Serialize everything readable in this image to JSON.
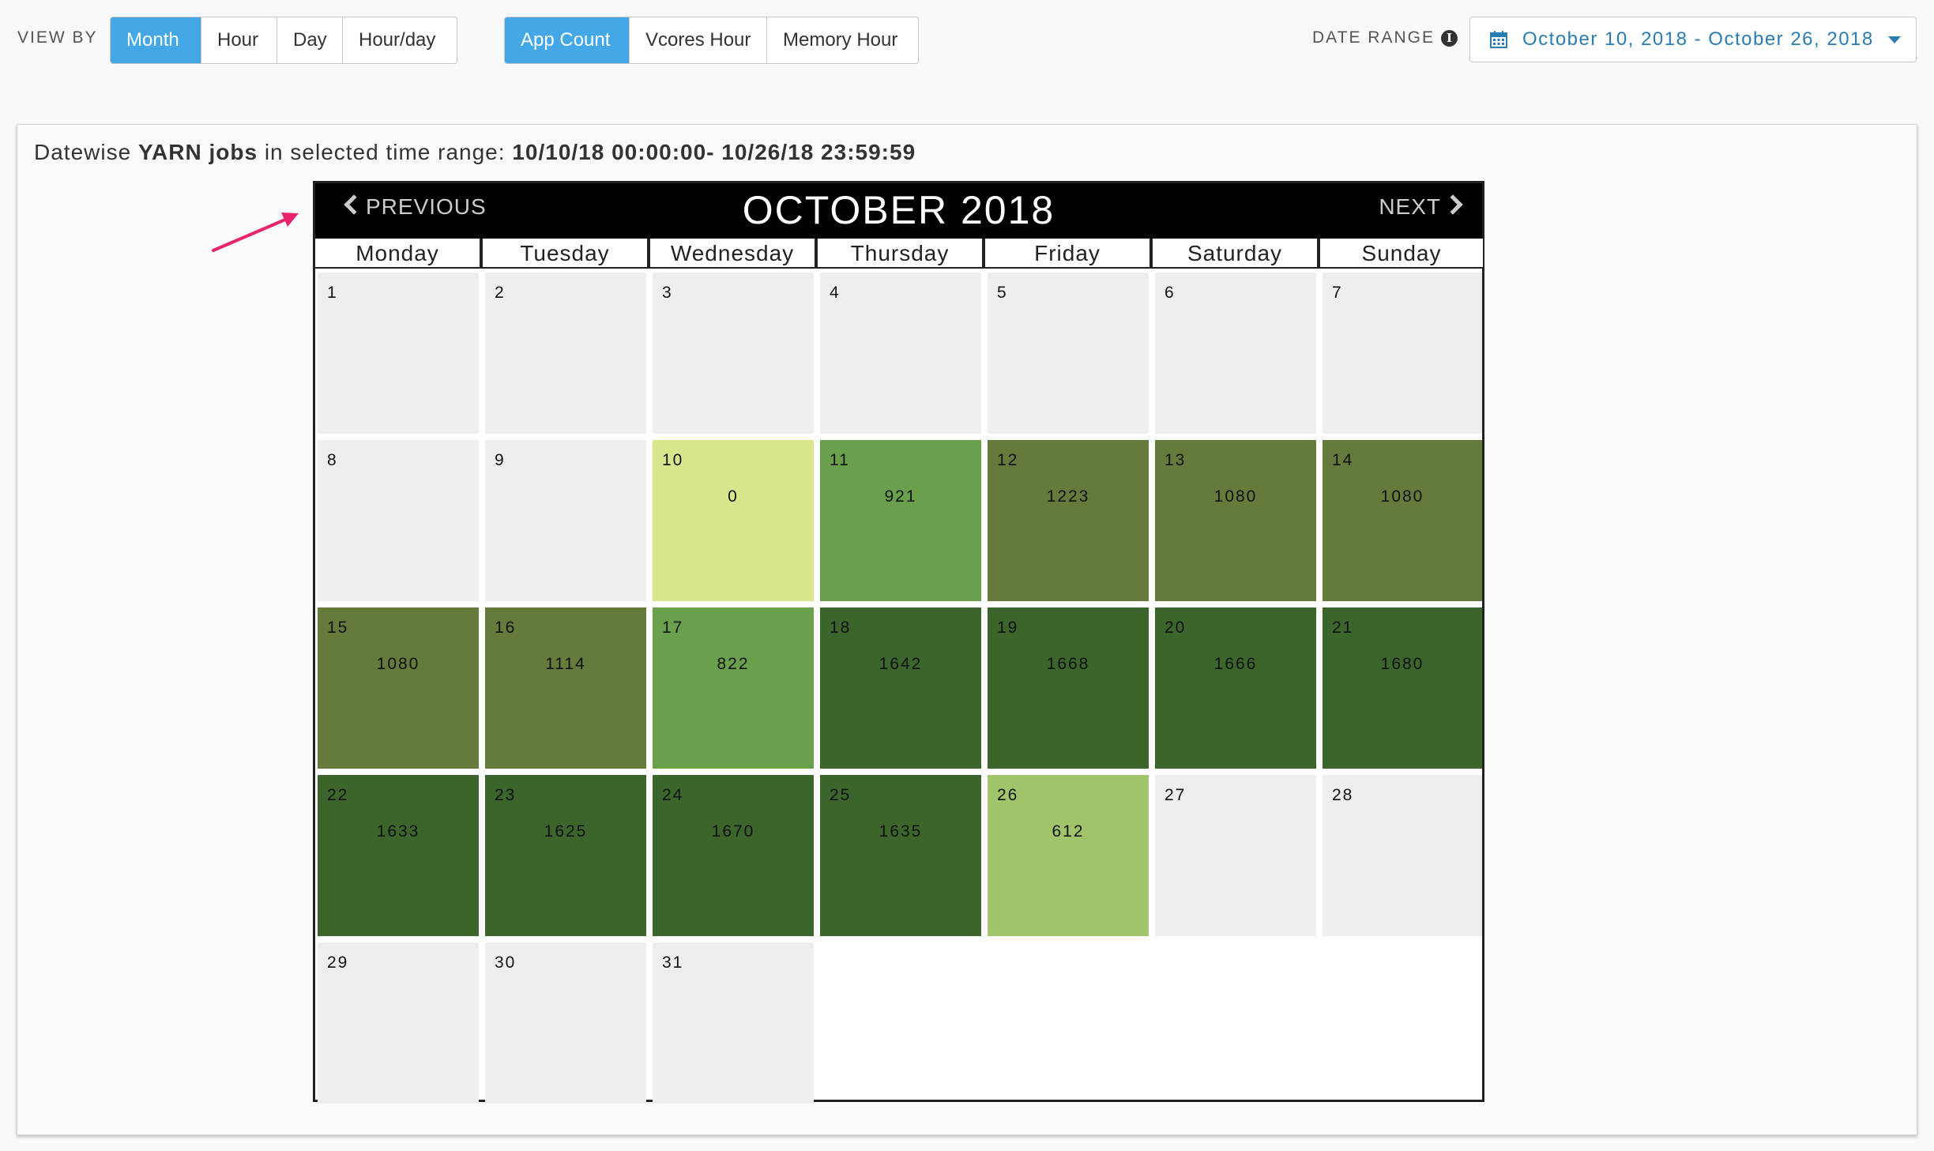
{
  "toolbar": {
    "view_by_label": "VIEW BY",
    "view_by_buttons": [
      "Month",
      "Hour",
      "Day",
      "Hour/day"
    ],
    "view_by_active": "Month",
    "metric_buttons": [
      "App Count",
      "Vcores Hour",
      "Memory Hour"
    ],
    "metric_active": "App Count",
    "date_range_label": "DATE RANGE",
    "date_range_value": "October 10, 2018 - October 26, 2018",
    "icons": {
      "info": "info-icon",
      "calendar": "calendar-icon",
      "dropdown": "caret-down-icon"
    }
  },
  "panel": {
    "title_prefix": "Datewise ",
    "title_bold": "YARN jobs",
    "title_middle": " in selected time range: ",
    "title_range": "10/10/18 00:00:00- 10/26/18 23:59:59"
  },
  "calendar": {
    "prev_label": "PREVIOUS",
    "next_label": "NEXT",
    "month_title": "OCTOBER 2018",
    "weekdays": [
      "Monday",
      "Tuesday",
      "Wednesday",
      "Thursday",
      "Friday",
      "Saturday",
      "Sunday"
    ],
    "empty_color": "#eeeeee",
    "days": [
      {
        "day": "1"
      },
      {
        "day": "2"
      },
      {
        "day": "3"
      },
      {
        "day": "4"
      },
      {
        "day": "5"
      },
      {
        "day": "6"
      },
      {
        "day": "7"
      },
      {
        "day": "8"
      },
      {
        "day": "9"
      },
      {
        "day": "10",
        "value": "0",
        "color": "#d9e68c"
      },
      {
        "day": "11",
        "value": "921",
        "color": "#6aa04b"
      },
      {
        "day": "12",
        "value": "1223",
        "color": "#657b3b"
      },
      {
        "day": "13",
        "value": "1080",
        "color": "#657b3b"
      },
      {
        "day": "14",
        "value": "1080",
        "color": "#657b3b"
      },
      {
        "day": "15",
        "value": "1080",
        "color": "#657b3b"
      },
      {
        "day": "16",
        "value": "1114",
        "color": "#657b3b"
      },
      {
        "day": "17",
        "value": "822",
        "color": "#6aa04b"
      },
      {
        "day": "18",
        "value": "1642",
        "color": "#3c652c"
      },
      {
        "day": "19",
        "value": "1668",
        "color": "#3c652c"
      },
      {
        "day": "20",
        "value": "1666",
        "color": "#3c652c"
      },
      {
        "day": "21",
        "value": "1680",
        "color": "#3c652c"
      },
      {
        "day": "22",
        "value": "1633",
        "color": "#3c652c"
      },
      {
        "day": "23",
        "value": "1625",
        "color": "#3c652c"
      },
      {
        "day": "24",
        "value": "1670",
        "color": "#3c652c"
      },
      {
        "day": "25",
        "value": "1635",
        "color": "#3c652c"
      },
      {
        "day": "26",
        "value": "612",
        "color": "#9fc46a"
      },
      {
        "day": "27"
      },
      {
        "day": "28"
      },
      {
        "day": "29"
      },
      {
        "day": "30"
      },
      {
        "day": "31"
      }
    ]
  },
  "annotation": {
    "arrow_color": "#e8246f",
    "icon": "pointer-arrow-icon"
  }
}
